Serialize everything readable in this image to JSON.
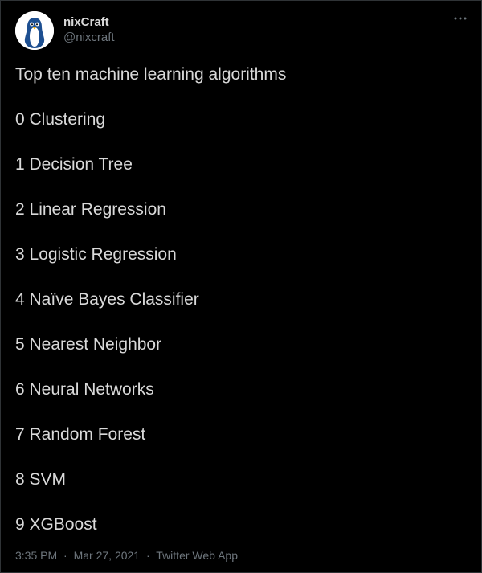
{
  "author": {
    "display_name": "nixCraft",
    "handle": "@nixcraft",
    "avatar_icon": "penguin-avatar-icon"
  },
  "more_icon": "more-options-icon",
  "tweet": {
    "lines": [
      "Top ten machine learning algorithms",
      "0 Clustering",
      "1 Decision Tree",
      "2 Linear Regression",
      "3 Logistic Regression",
      "4 Naïve Bayes Classifier",
      "5 Nearest Neighbor",
      "6 Neural Networks",
      "7 Random Forest",
      "8 SVM",
      "9 XGBoost"
    ]
  },
  "meta": {
    "time": "3:35 PM",
    "separator": "·",
    "date": "Mar 27, 2021",
    "source": "Twitter Web App"
  },
  "colors": {
    "background": "#000000",
    "text": "#d9d9d9",
    "secondary_text": "#6e767d",
    "border": "#2f3336",
    "avatar_accent": "#1d4f91"
  }
}
